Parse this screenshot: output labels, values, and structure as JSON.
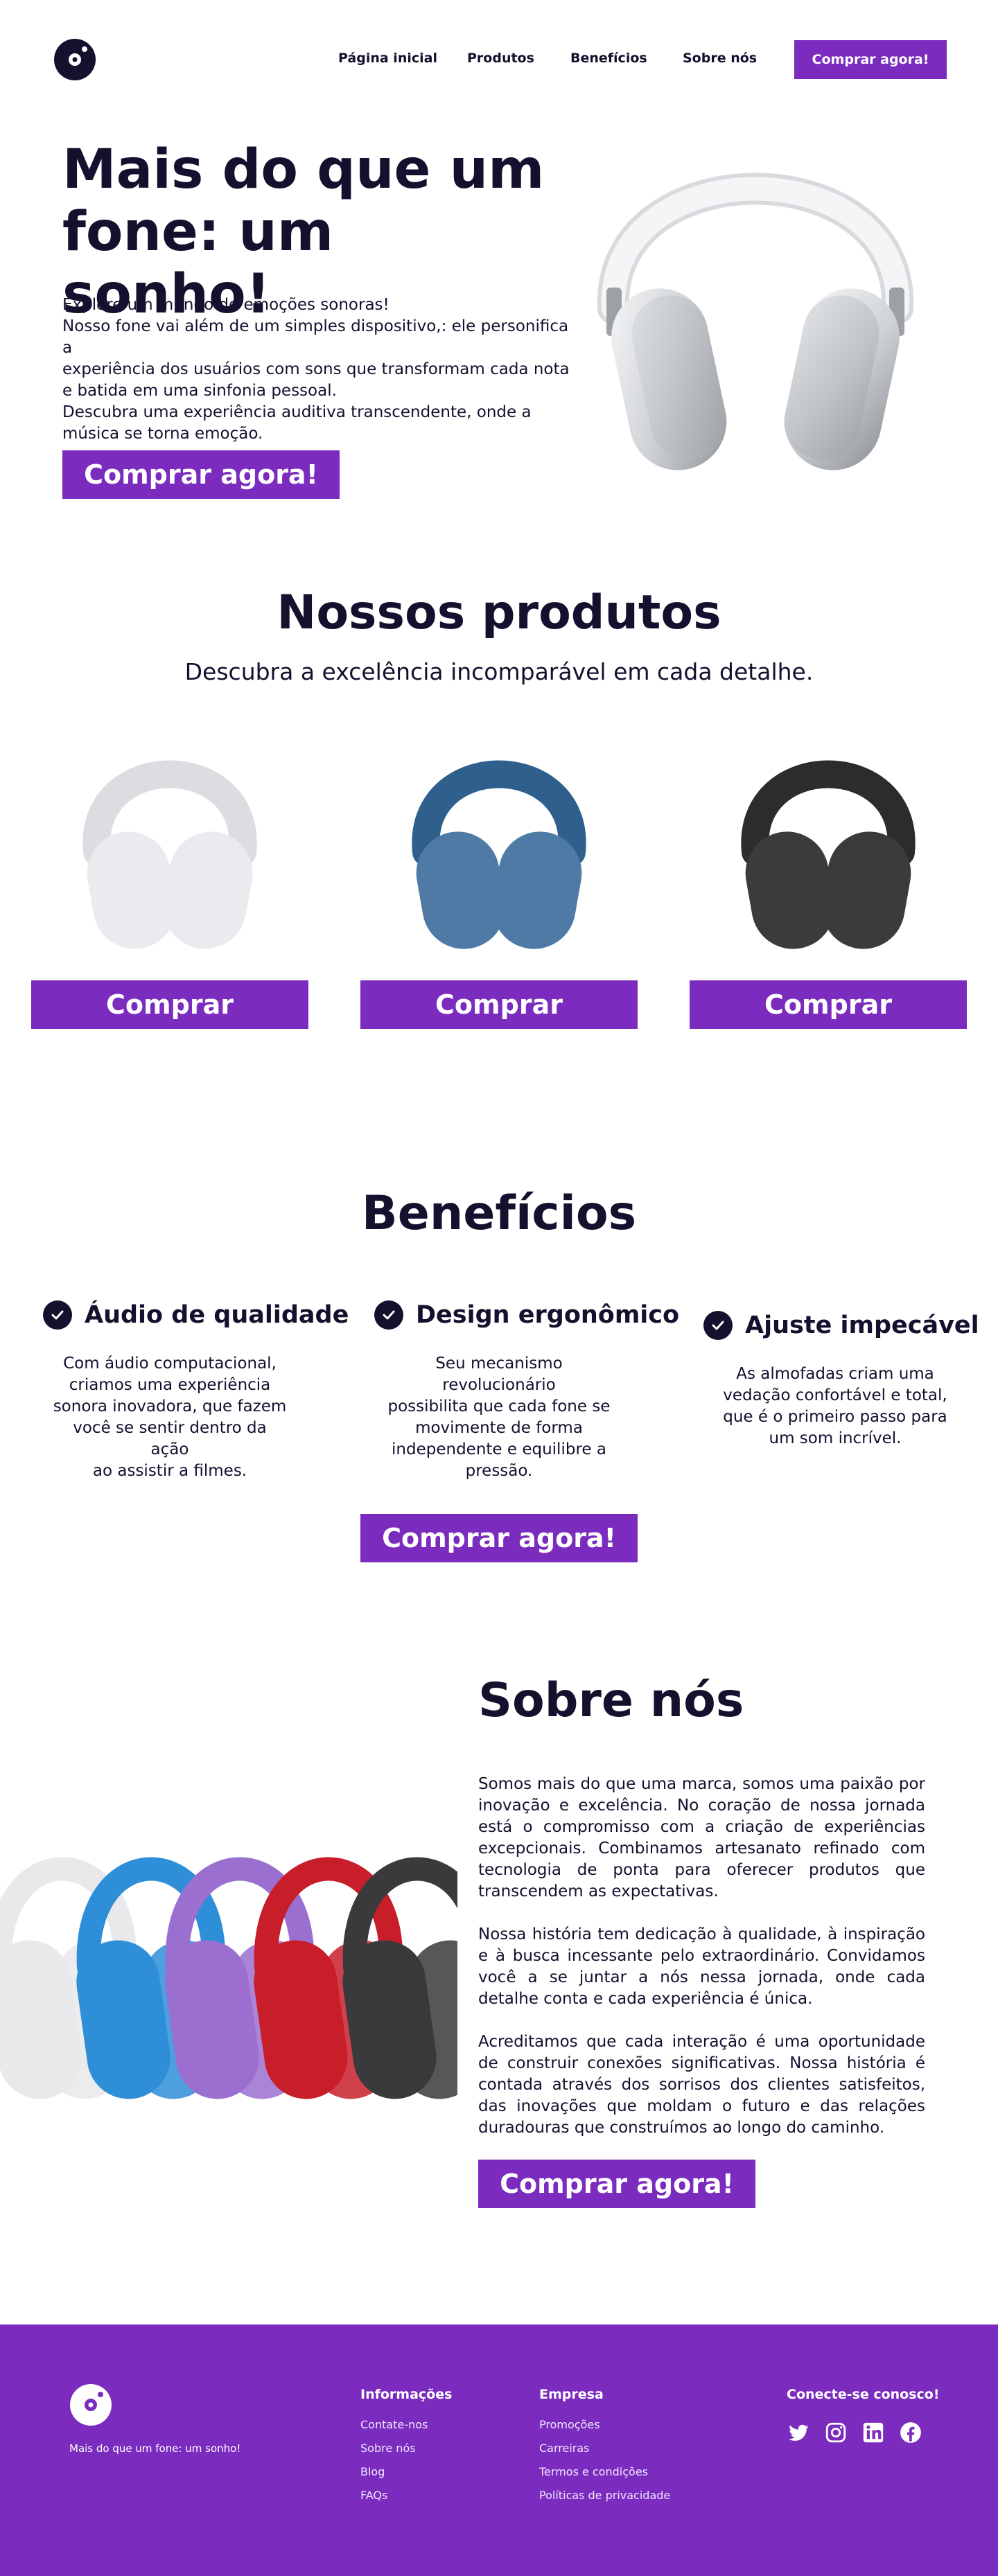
{
  "nav": {
    "links": [
      "Página inicial",
      "Produtos",
      "Benefícios",
      "Sobre nós"
    ],
    "cta": "Comprar agora!"
  },
  "hero": {
    "title_line1": "Mais do que um",
    "title_line2": "fone: um sonho!",
    "text_lines": [
      "Explore um mundo de emoções sonoras!",
      "Nosso fone vai além de um simples dispositivo,: ele personifica a",
      "experiência dos usuários com sons que transformam cada nota",
      "e batida em uma sinfonia pessoal.",
      "Descubra uma experiência auditiva transcendente, onde a",
      "música se torna emoção."
    ],
    "cta": "Comprar agora!"
  },
  "products": {
    "title": "Nossos produtos",
    "subtitle": "Descubra a excelência incomparável em cada detalhe.",
    "items": [
      {
        "color": "#e9ebee",
        "button": "Comprar"
      },
      {
        "color": "#4f7aa6",
        "button": "Comprar"
      },
      {
        "color": "#3b3b3d",
        "button": "Comprar"
      }
    ]
  },
  "benefits": {
    "title": "Benefícios",
    "items": [
      {
        "heading": "Áudio de qualidade",
        "lines": [
          "Com áudio computacional,",
          "criamos uma experiência",
          "sonora inovadora, que fazem",
          "você se sentir dentro da ação",
          "ao assistir a filmes."
        ]
      },
      {
        "heading": "Design ergonômico",
        "lines": [
          "Seu mecanismo revolucionário",
          "possibilita que cada fone se",
          "movimente de forma",
          "independente e equilibre a",
          "pressão."
        ]
      },
      {
        "heading": "Ajuste impecável",
        "lines": [
          "As almofadas criam uma",
          "vedação confortável e total,",
          "que é o primeiro passo para",
          "um som incrível."
        ]
      }
    ],
    "cta": "Comprar agora!"
  },
  "about": {
    "title": "Sobre nós",
    "paragraphs": [
      "Somos mais do que uma marca, somos uma paixão por inovação e excelência. No coração de nossa jornada está o compromisso com a criação de experiências excepcionais. Combinamos artesanato refinado com tecnologia de ponta para oferecer produtos que transcendem as expectativas.",
      "Nossa história tem dedicação à qualidade, à inspiração e à busca incessante pelo extraordinário. Convidamos você a se juntar a nós nessa jornada, onde cada detalhe conta e cada experiência é única.",
      "Acreditamos que cada interação é uma oportunidade de construir conexões significativas. Nossa história é contada através dos sorrisos dos clientes satisfeitos, das inovações que moldam o futuro e das relações duradouras que construímos ao longo do caminho."
    ],
    "cta": "Comprar agora!",
    "colors": [
      "#e9e9ec",
      "#2f8ed8",
      "#9b6fd0",
      "#c81e2a",
      "#3a3a3c"
    ]
  },
  "footer": {
    "tagline": "Mais do que um fone: um sonho!",
    "info_title": "Informações",
    "info_links": [
      "Contate-nos",
      "Sobre nós",
      "Blog",
      "FAQs"
    ],
    "company_title": "Empresa",
    "company_links": [
      "Promoções",
      "Carreiras",
      "Termos e condições",
      "Políticas de privacidade"
    ],
    "connect_title": "Conecte-se conosco!",
    "social_icons": [
      "twitter-icon",
      "instagram-icon",
      "linkedin-icon",
      "facebook-icon"
    ]
  },
  "colors": {
    "primary": "#7b2cbf",
    "dark": "#14102e"
  }
}
